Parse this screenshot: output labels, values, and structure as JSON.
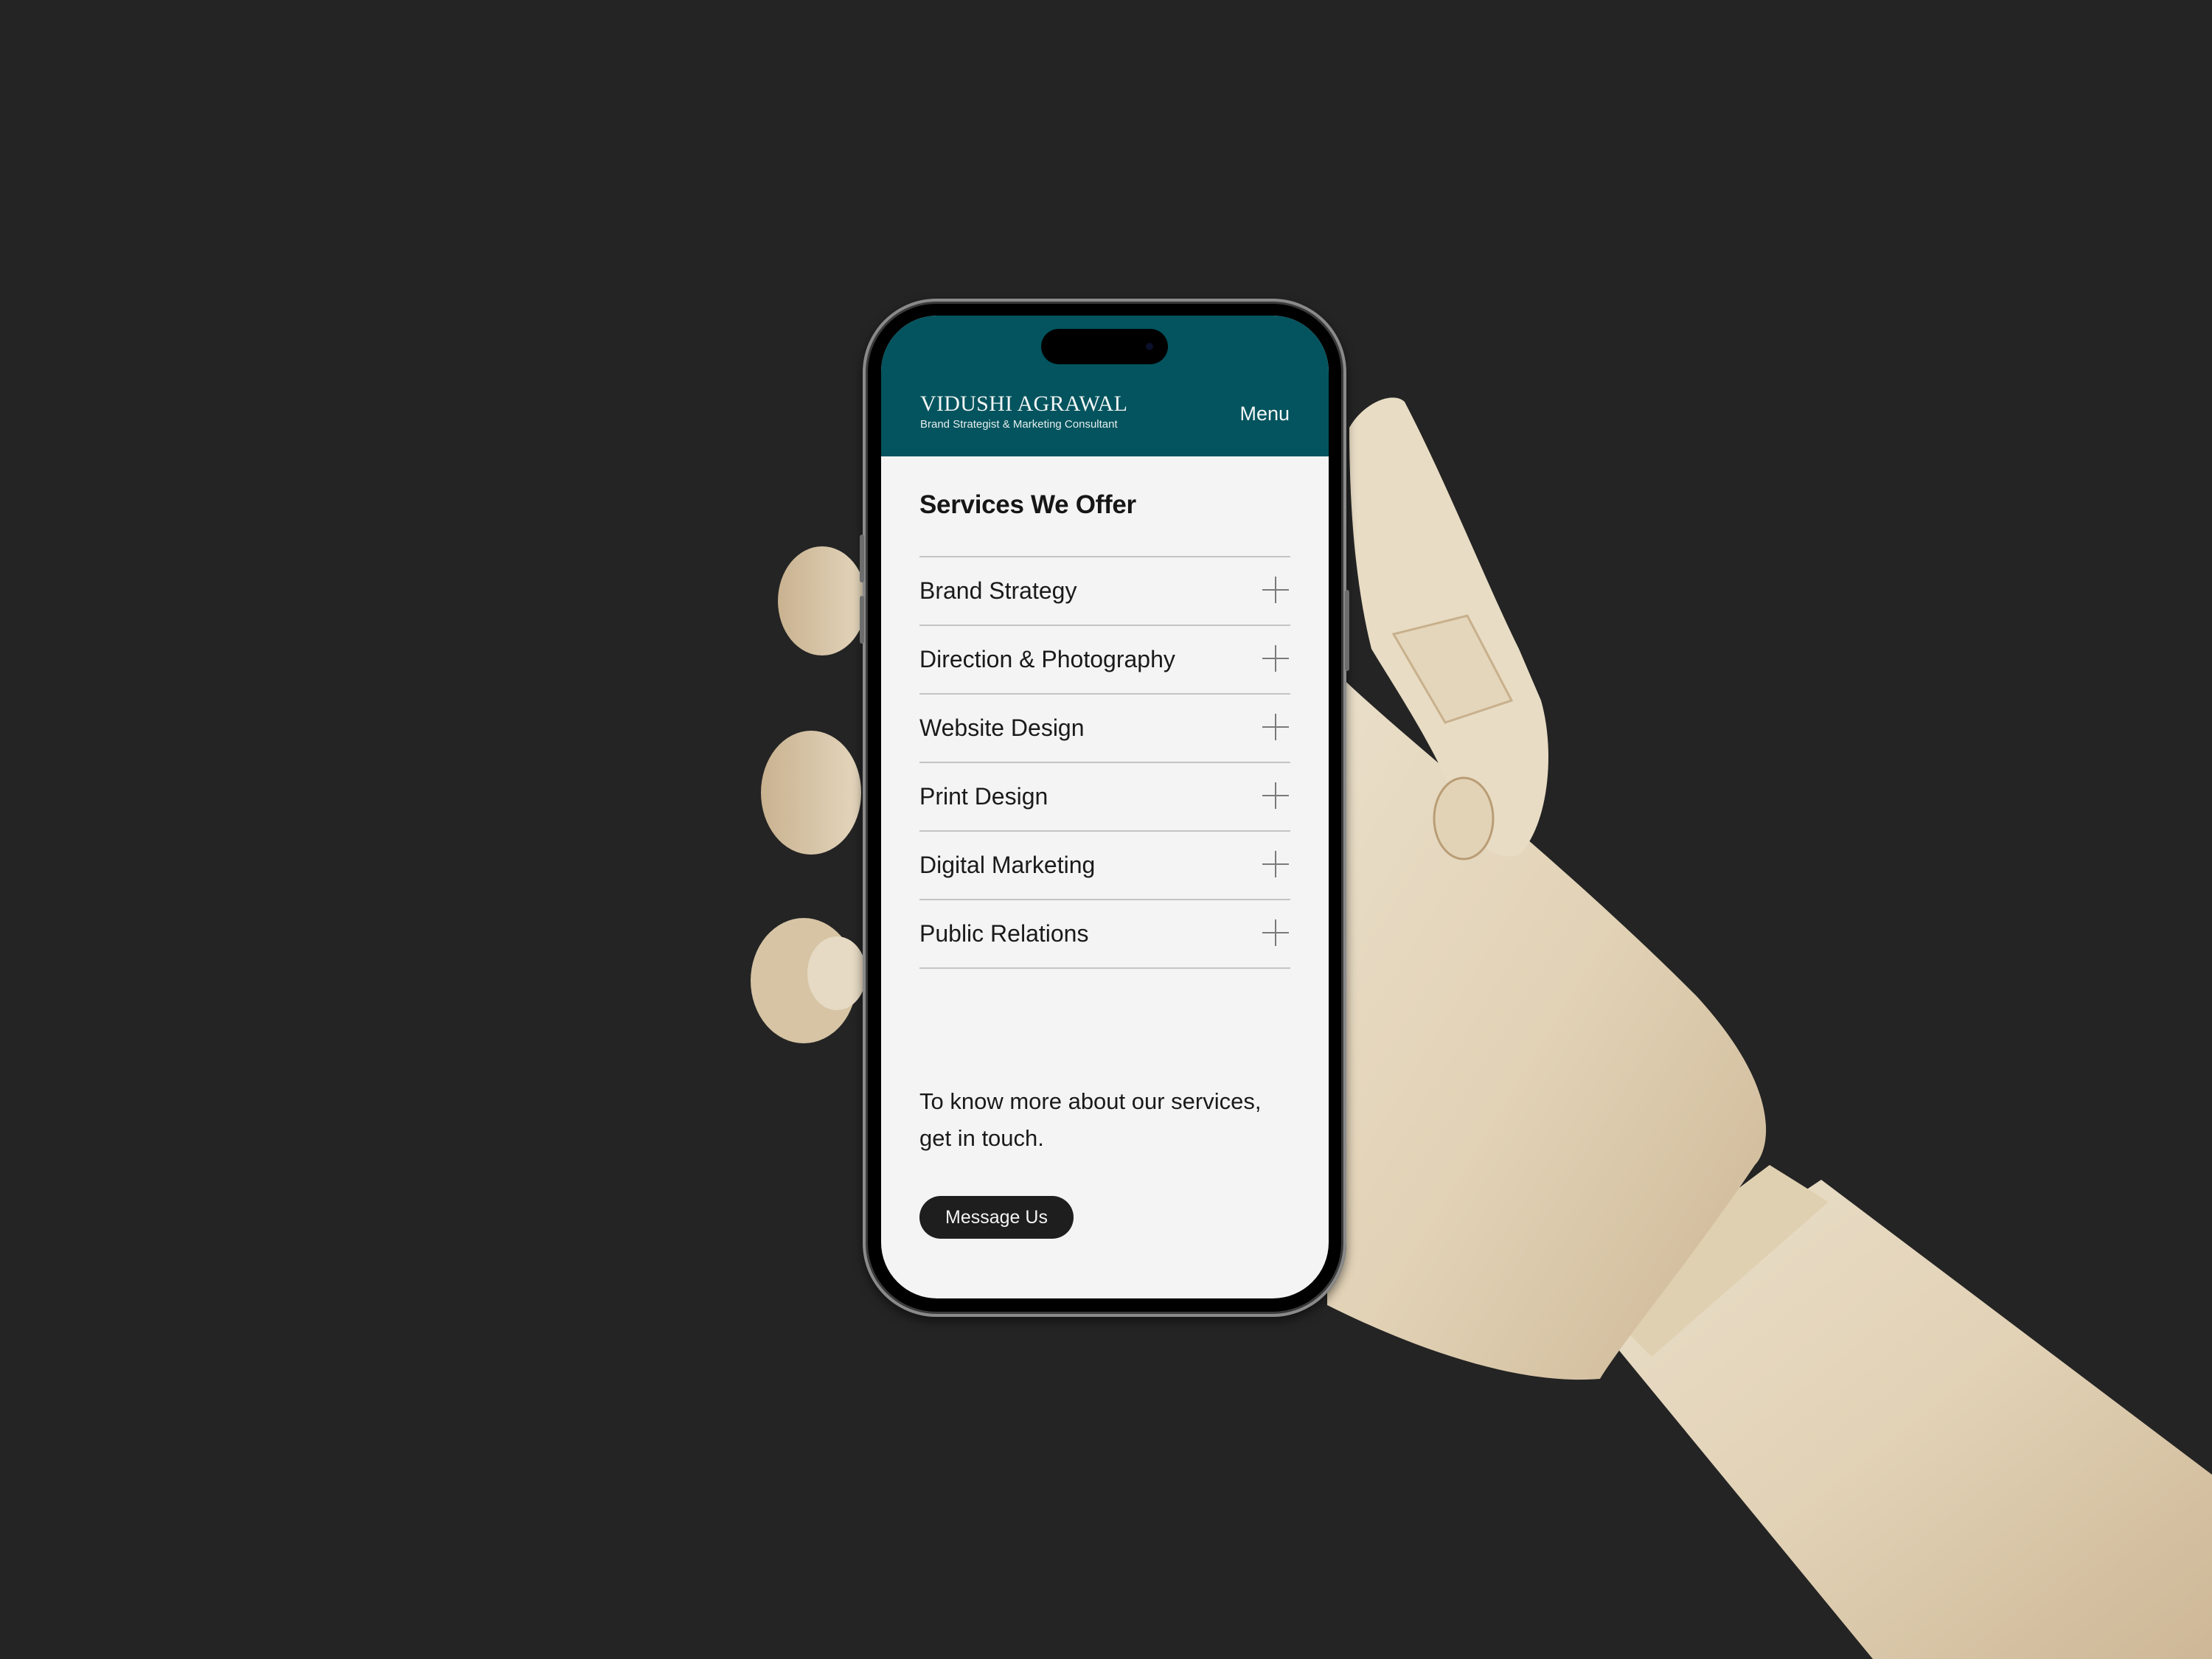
{
  "header": {
    "brand_name": "VIDUSHI AGRAWAL",
    "tagline": "Brand Strategist & Marketing Consultant",
    "menu_label": "Menu"
  },
  "services_section": {
    "title": "Services We Offer",
    "items": [
      {
        "label": "Brand Strategy",
        "icon": "plus-icon"
      },
      {
        "label": "Direction & Photography",
        "icon": "plus-icon"
      },
      {
        "label": "Website Design",
        "icon": "plus-icon"
      },
      {
        "label": "Print Design",
        "icon": "plus-icon"
      },
      {
        "label": "Digital Marketing",
        "icon": "plus-icon"
      },
      {
        "label": "Public Relations",
        "icon": "plus-icon"
      }
    ]
  },
  "contact": {
    "note": "To know more about our services, get in touch.",
    "button_label": "Message Us"
  },
  "colors": {
    "header_bg": "#03545e",
    "page_bg": "#f4f4f4",
    "button_bg": "#1e1e1e",
    "backdrop": "#242424"
  }
}
